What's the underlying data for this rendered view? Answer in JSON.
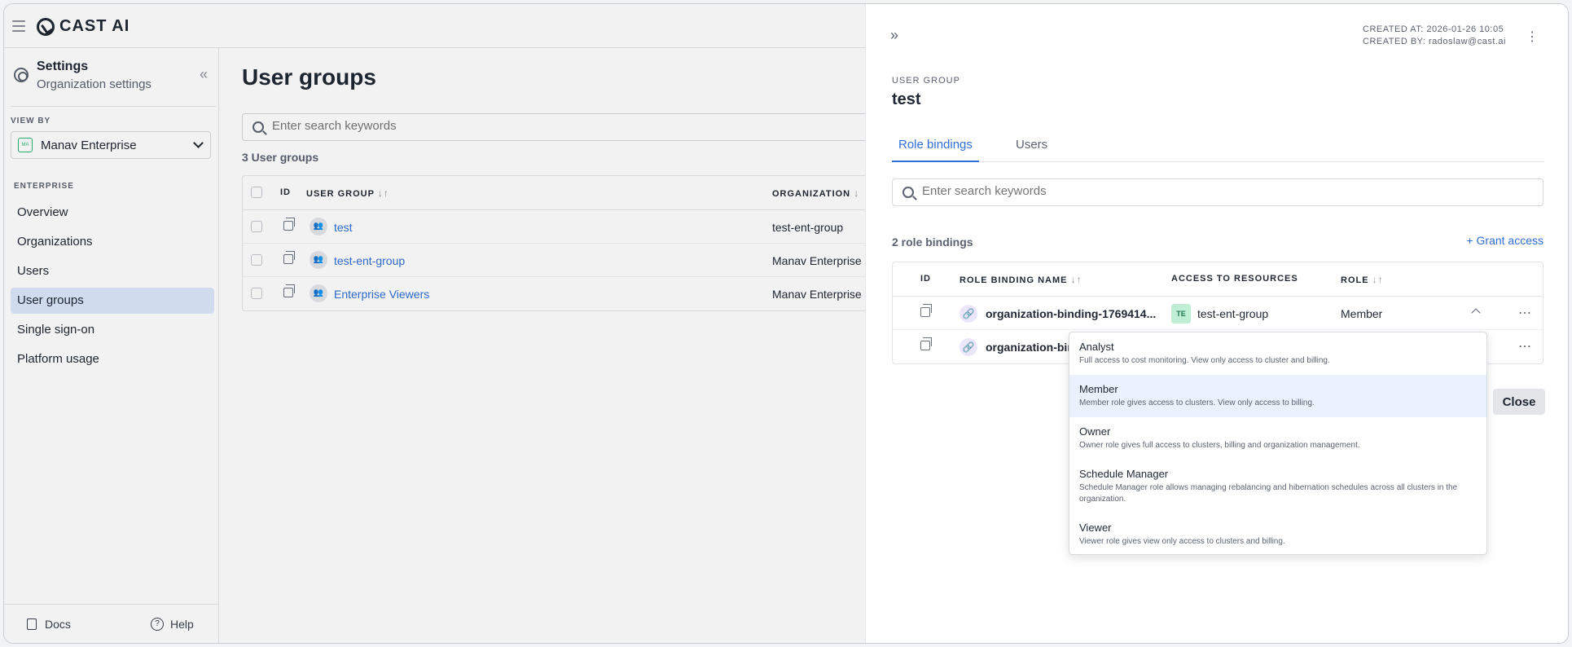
{
  "app": {
    "logo_text": "CAST AI"
  },
  "sidebar": {
    "title": "Settings",
    "subtitle": "Organization settings",
    "view_by_label": "VIEW BY",
    "org_selector": {
      "badge": "MA",
      "value": "Manav Enterprise"
    },
    "section_label": "ENTERPRISE",
    "items": [
      {
        "label": "Overview"
      },
      {
        "label": "Organizations"
      },
      {
        "label": "Users"
      },
      {
        "label": "User groups"
      },
      {
        "label": "Single sign-on"
      },
      {
        "label": "Platform usage"
      }
    ],
    "active_item": "User groups",
    "footer": {
      "docs": "Docs",
      "help": "Help"
    }
  },
  "main": {
    "title": "User groups",
    "search_placeholder": "Enter search keywords",
    "count": "3 User groups",
    "columns": [
      "ID",
      "USER GROUP",
      "ORGANIZATION"
    ],
    "rows": [
      {
        "name": "test",
        "org": "test-ent-group"
      },
      {
        "name": "test-ent-group",
        "org": "Manav Enterprise"
      },
      {
        "name": "Enterprise Viewers",
        "org": "Manav Enterprise"
      }
    ]
  },
  "panel": {
    "created_at": "CREATED AT: 2026-01-26 10:05",
    "created_by": "CREATED BY: radoslaw@cast.ai",
    "caption": "USER GROUP",
    "title": "test",
    "tabs": [
      {
        "label": "Role bindings"
      },
      {
        "label": "Users"
      }
    ],
    "active_tab": "Role bindings",
    "search_placeholder": "Enter search keywords",
    "count": "2 role bindings",
    "grant_label": "Grant access",
    "columns": [
      "ID",
      "ROLE BINDING NAME",
      "ACCESS TO RESOURCES",
      "ROLE"
    ],
    "rows": [
      {
        "name": "organization-binding-1769414...",
        "resource_badge": "TE",
        "resource": "test-ent-group",
        "role": "Member"
      },
      {
        "name": "organization-bin"
      }
    ],
    "close_label": "Close"
  },
  "dropdown": {
    "options": [
      {
        "title": "Analyst",
        "desc": "Full access to cost monitoring. View only access to cluster and billing."
      },
      {
        "title": "Member",
        "desc": "Member role gives access to clusters. View only access to billing."
      },
      {
        "title": "Owner",
        "desc": "Owner role gives full access to clusters, billing and organization management."
      },
      {
        "title": "Schedule Manager",
        "desc": "Schedule Manager role allows managing rebalancing and hibernation schedules across all clusters in the organization."
      },
      {
        "title": "Viewer",
        "desc": "Viewer role gives view only access to clusters and billing."
      }
    ],
    "selected": "Member"
  },
  "colors": {
    "accent": "#2f6fd6",
    "active_bg": "#dce8fb",
    "badge_green": "#bfeed5"
  }
}
